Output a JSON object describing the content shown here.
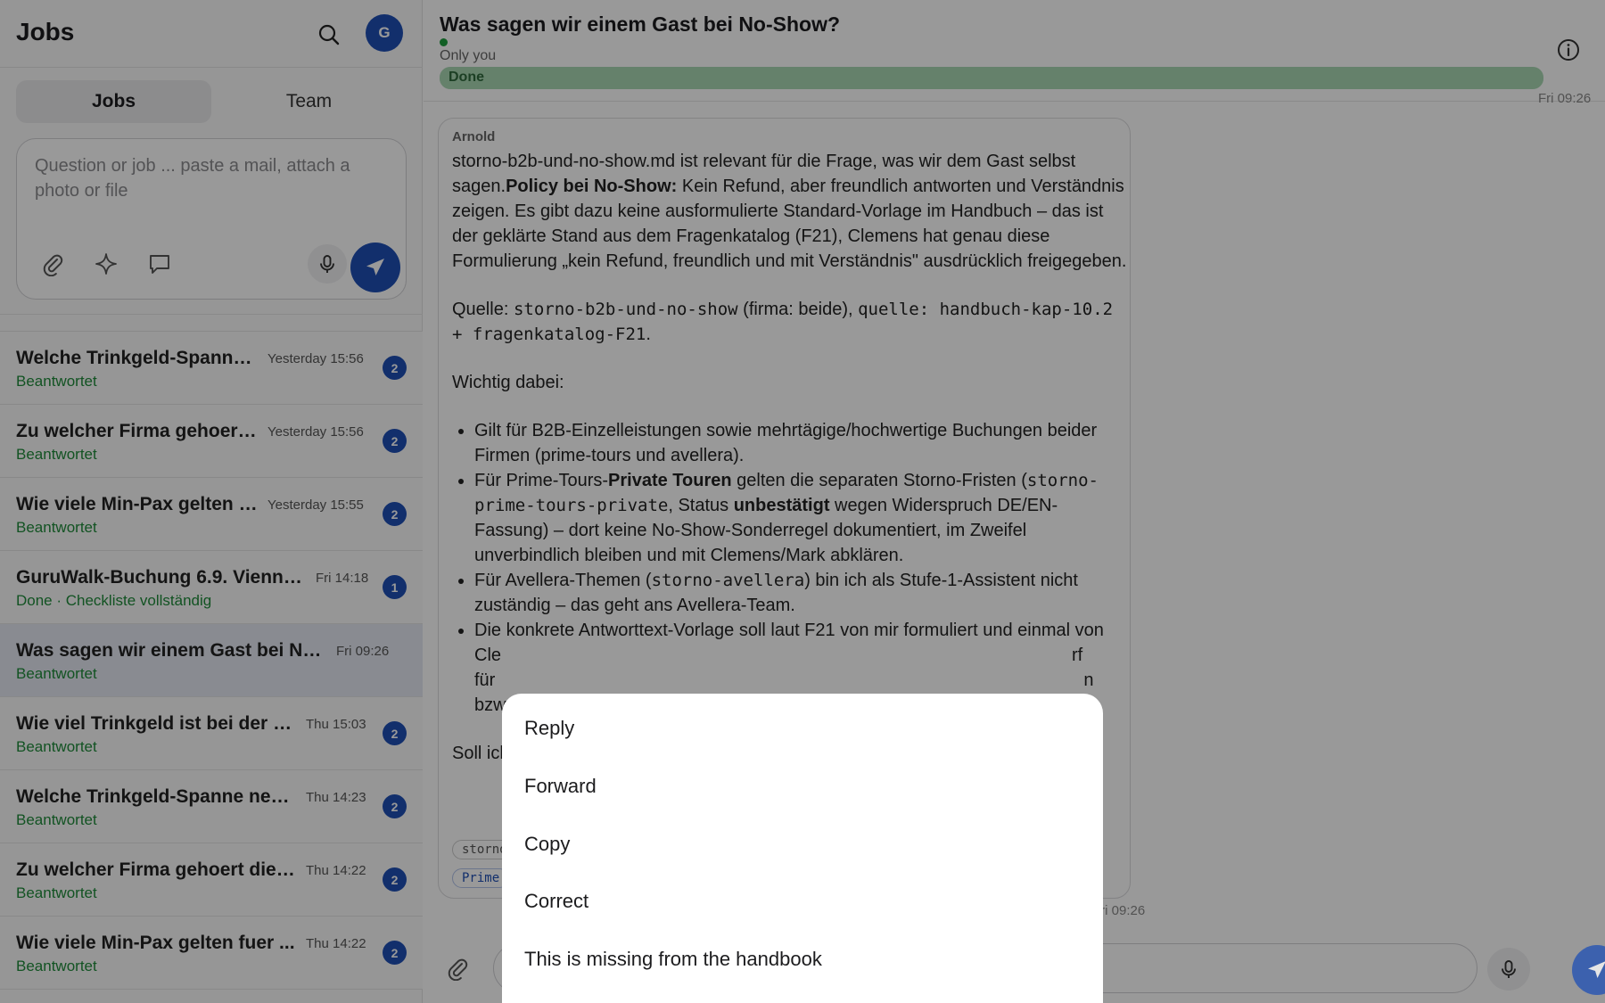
{
  "sidebar": {
    "title": "Jobs",
    "avatar_initial": "G",
    "tabs": [
      {
        "label": "Jobs",
        "active": true
      },
      {
        "label": "Team",
        "active": false
      }
    ],
    "composer": {
      "placeholder": "Question or job ... paste a mail, attach a photo or file"
    },
    "jobs": [
      {
        "title": "Welche Trinkgeld-Spanne ...",
        "time": "Yesterday 15:56",
        "status": "Beantwortet",
        "badge": "2"
      },
      {
        "title": "Zu welcher Firma gehoert ...",
        "time": "Yesterday 15:56",
        "status": "Beantwortet",
        "badge": "2"
      },
      {
        "title": "Wie viele Min-Pax gelten f...",
        "time": "Yesterday 15:55",
        "status": "Beantwortet",
        "badge": "2"
      },
      {
        "title": "GuruWalk-Buchung 6.9. Vienna ...",
        "time": "Fri 14:18",
        "status": "Done · Checkliste vollständig",
        "badge": "1"
      },
      {
        "title": "Was sagen wir einem Gast bei No-...",
        "time": "Fri 09:26",
        "status": "Beantwortet",
        "badge": ""
      },
      {
        "title": "Wie viel Trinkgeld ist bei der Fr...",
        "time": "Thu 15:03",
        "status": "Beantwortet",
        "badge": "2"
      },
      {
        "title": "Welche Trinkgeld-Spanne nen...",
        "time": "Thu 14:23",
        "status": "Beantwortet",
        "badge": "2"
      },
      {
        "title": "Zu welcher Firma gehoert die ...",
        "time": "Thu 14:22",
        "status": "Beantwortet",
        "badge": "2"
      },
      {
        "title": "Wie viele Min-Pax gelten fuer ...",
        "time": "Thu 14:22",
        "status": "Beantwortet",
        "badge": "2"
      }
    ]
  },
  "conversation": {
    "title": "Was sagen wir einem Gast bei No-Show?",
    "visibility": "Only you",
    "status_label": "Done",
    "status_progress": 1.0,
    "top_timestamp": "Fri 09:26",
    "message": {
      "author": "Arnold",
      "p1_a": "storno-b2b-und-no-show.md ist relevant für die Frage, was wir dem Gast selbst sagen.",
      "p1_bold": "Policy bei No-Show:",
      "p1_b": " Kein Refund, aber freundlich antworten und Verständnis zeigen. Es gibt dazu keine ausformulierte Standard-Vorlage im Handbuch – das ist der geklärte Stand aus dem Fragenkatalog (F21), Clemens hat genau diese Formulierung „kein Refund, freundlich und mit Verständnis\" ausdrücklich freigegeben.",
      "p2_a": "Quelle: ",
      "p2_code1": "storno-b2b-und-no-show",
      "p2_b": " (firma: beide), ",
      "p2_code2": "quelle: handbuch-kap-10.2 + fragenkatalog-F21",
      "p2_c": ".",
      "p3": "Wichtig dabei:",
      "b1": "Gilt für B2B-Einzelleistungen sowie mehrtägige/hochwertige Buchungen beider Firmen (prime-tours und avellera).",
      "b2_a": "Für Prime-Tours-",
      "b2_bold1": "Private Touren",
      "b2_b": " gelten die separaten Storno-Fristen (",
      "b2_code": "storno-prime-tours-private",
      "b2_c": ", Status ",
      "b2_bold2": "unbestätigt",
      "b2_d": " wegen Widerspruch DE/EN-Fassung) – dort keine No-Show-Sonderregel dokumentiert, im Zweifel unverbindlich bleiben und mit Clemens/Mark abklären.",
      "b3_a": "Für Avellera-Themen (",
      "b3_code": "storno-avellera",
      "b3_b": ") bin ich als Stufe-1-Assistent nicht zuständig – das geht ans Avellera-Team.",
      "b4_start": "Die konkrete Antworttext-Vorlage soll laut F21 von mir formuliert und einmal von",
      "b4_l2a": "Cle",
      "b4_l2b": "rf",
      "b4_l3a": "für",
      "b4_l3b": "n",
      "b4_l4": "bzw",
      "p4": "Soll ich",
      "tag1": "storno",
      "tag2": "Prime",
      "timestamp": "Fri 09:26"
    }
  },
  "context_menu": {
    "items": [
      "Reply",
      "Forward",
      "Copy",
      "Correct",
      "This is missing from the handbook"
    ]
  },
  "colors": {
    "accent": "#1e4fb5",
    "status_green": "#1e8a3a",
    "overlay": "rgba(0,0,0,0.40)"
  },
  "icons": {
    "search": "search-icon",
    "info": "info-icon",
    "attach": "paperclip-icon",
    "sparkle": "sparkle-icon",
    "chat": "chat-icon",
    "mic": "microphone-icon",
    "send": "send-icon"
  }
}
